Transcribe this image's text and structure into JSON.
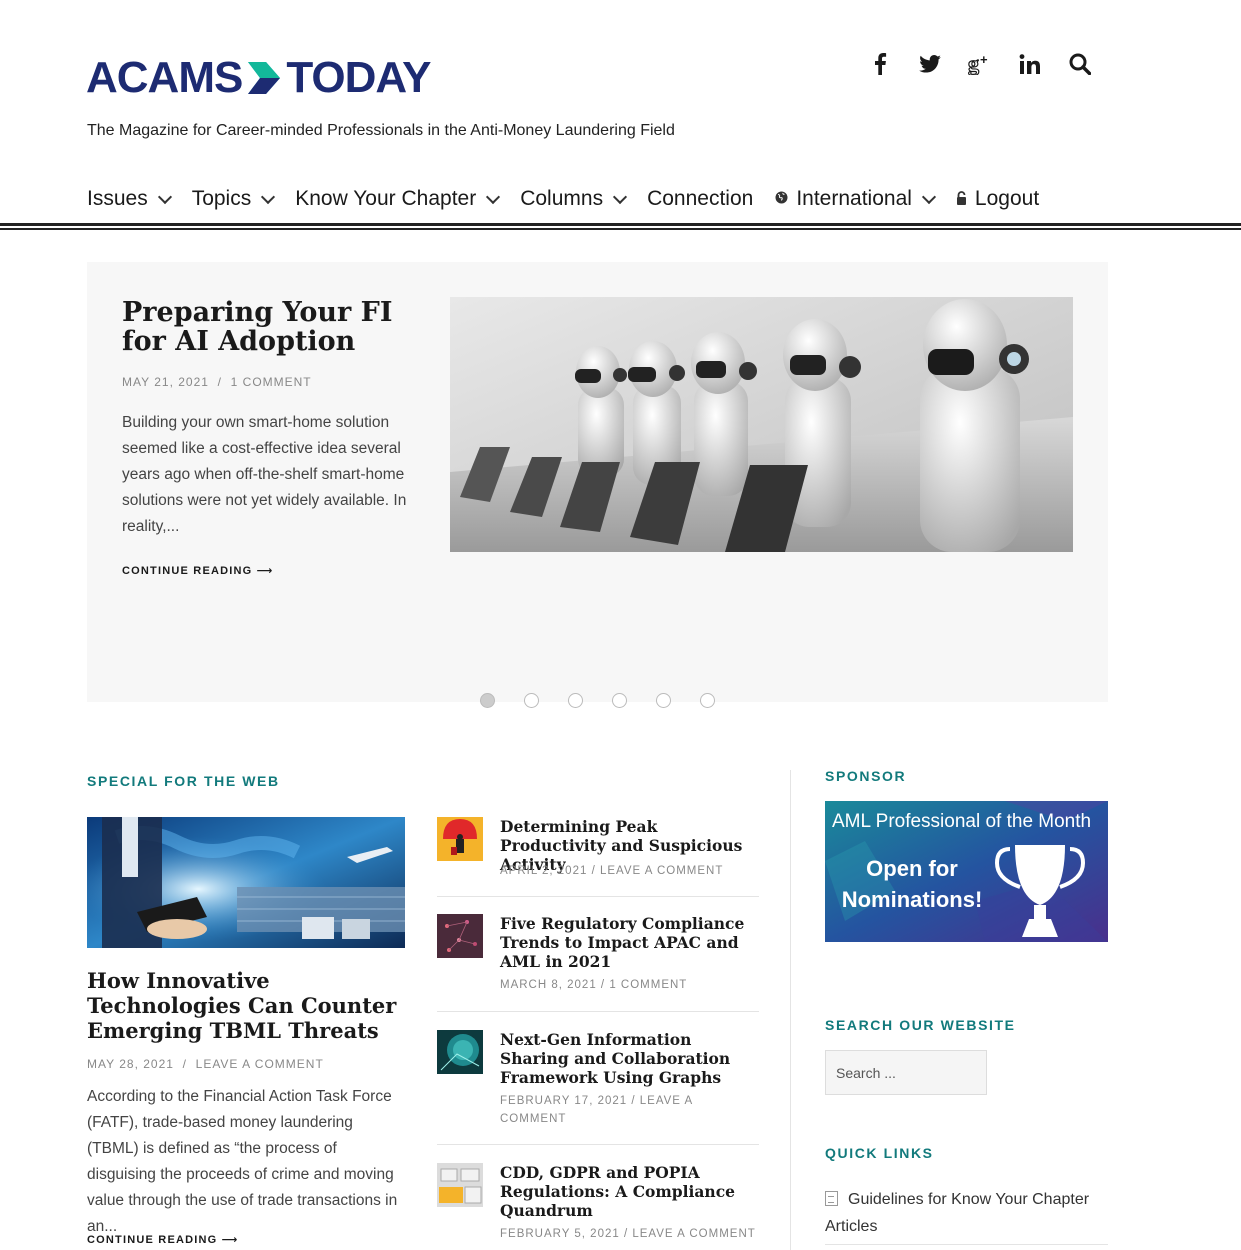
{
  "brand": {
    "logo_left": "ACAMS",
    "logo_right": "TODAY",
    "tagline": "The Magazine for Career-minded Professionals in the Anti-Money Laundering Field",
    "colors": {
      "navy": "#1d2b72",
      "teal": "#127a7c",
      "chevron_green": "#13b89a",
      "chevron_blue": "#1aa7d6"
    }
  },
  "social": [
    {
      "name": "facebook-icon",
      "glyph": "f"
    },
    {
      "name": "twitter-icon",
      "glyph": "🐦"
    },
    {
      "name": "google-plus-icon",
      "glyph": "g+"
    },
    {
      "name": "linkedin-icon",
      "glyph": "in"
    },
    {
      "name": "search-icon",
      "glyph": "🔍"
    }
  ],
  "nav": {
    "issues": "Issues",
    "topics": "Topics",
    "chapter": "Know Your Chapter",
    "columns": "Columns",
    "connection": "Connection",
    "international": "International",
    "logout": "Logout"
  },
  "featured": {
    "title": "Preparing Your FI for AI Adoption",
    "date": "MAY 21, 2021",
    "comments": "1 COMMENT",
    "excerpt": "Building your own smart-home solution seemed like a cost-effective idea several years ago when off-the-shelf smart-home solutions were not yet widely available. In reality,...",
    "cta": "CONTINUE READING ⟶",
    "slide_count": 6,
    "active_slide": 1
  },
  "special": {
    "heading": "SPECIAL FOR THE WEB",
    "title": "How Innovative Technologies Can Counter Emerging TBML Threats",
    "date": "MAY 28, 2021",
    "comments": "LEAVE A COMMENT",
    "excerpt": "According to the Financial Action Task Force (FATF), trade-based money laundering (TBML) is defined as “the process of disguising the proceeds of crime and moving value through the use of trade transactions in an...",
    "cta": "CONTINUE READING ⟶"
  },
  "posts": [
    {
      "title": "Determining Peak Productivity and Suspicious Activity",
      "meta": "APRIL 2, 2021  /  LEAVE A COMMENT"
    },
    {
      "title": "Five Regulatory Compliance Trends to Impact APAC and AML in 2021",
      "meta": "MARCH 8, 2021  /  1 COMMENT"
    },
    {
      "title": "Next-Gen Information Sharing and Collaboration Framework Using Graphs",
      "meta": "FEBRUARY 17, 2021  /  LEAVE A COMMENT"
    },
    {
      "title": "CDD, GDPR and POPIA Regulations: A Compliance Quandrum",
      "meta": "FEBRUARY 5, 2021  /  LEAVE A COMMENT"
    }
  ],
  "sidebar": {
    "sponsor_heading": "SPONSOR",
    "sponsor_line1": "AML Professional of the Month",
    "sponsor_line2": "Open for Nominations!",
    "search_heading": "SEARCH OUR WEBSITE",
    "search_placeholder": "Search ...",
    "links_heading": "QUICK LINKS",
    "link1": "Guidelines for Know Your Chapter Articles"
  }
}
